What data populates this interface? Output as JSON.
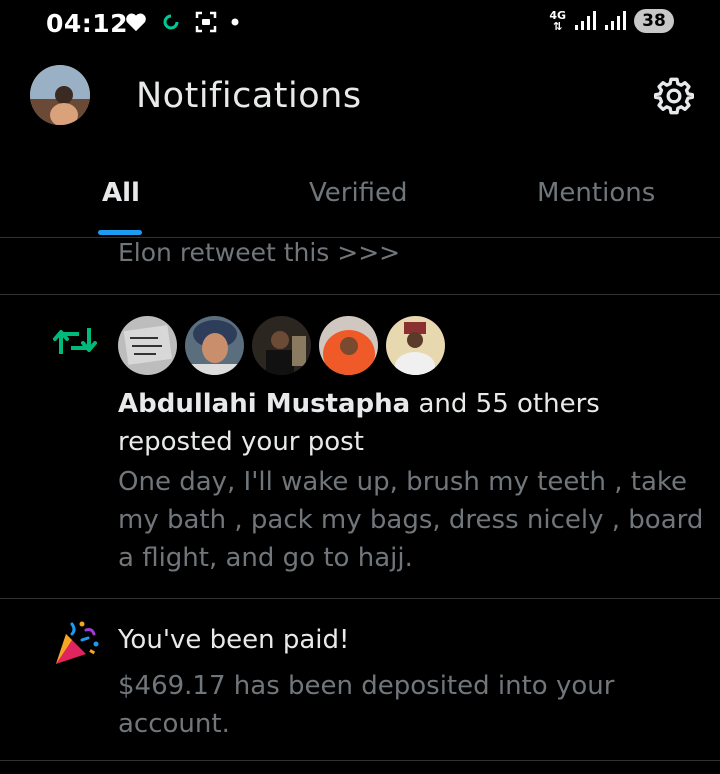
{
  "status_bar": {
    "time": "04:12",
    "network": "4G",
    "battery": "38",
    "icons": [
      "heart-icon",
      "sync-icon",
      "screenshot-icon",
      "dot-icon",
      "signal-icon",
      "signal-icon",
      "battery-icon"
    ]
  },
  "header": {
    "title": "Notifications",
    "settings_icon": "gear-icon"
  },
  "tabs": [
    {
      "label": "All",
      "active": true
    },
    {
      "label": "Verified",
      "active": false
    },
    {
      "label": "Mentions",
      "active": false
    }
  ],
  "previous_item": {
    "text": "Elon retweet this >>>"
  },
  "notifications": [
    {
      "type": "repost",
      "icon": "repost-icon",
      "actor": "Abdullahi Mustapha",
      "action": " and 55 others reposted your post",
      "post_text": "One day, I'll wake up, brush my teeth , take my bath , pack my bags, dress nicely , board a flight, and go to hajj."
    },
    {
      "type": "payment",
      "icon": "party-popper-icon",
      "title": "You've been paid!",
      "body": "$469.17 has been deposited into your account."
    }
  ],
  "colors": {
    "background": "#000000",
    "text_primary": "#e7e9ea",
    "text_secondary": "#71767b",
    "accent": "#1d9bf0",
    "repost_green": "#00ba7c",
    "divider": "#2f3336"
  }
}
